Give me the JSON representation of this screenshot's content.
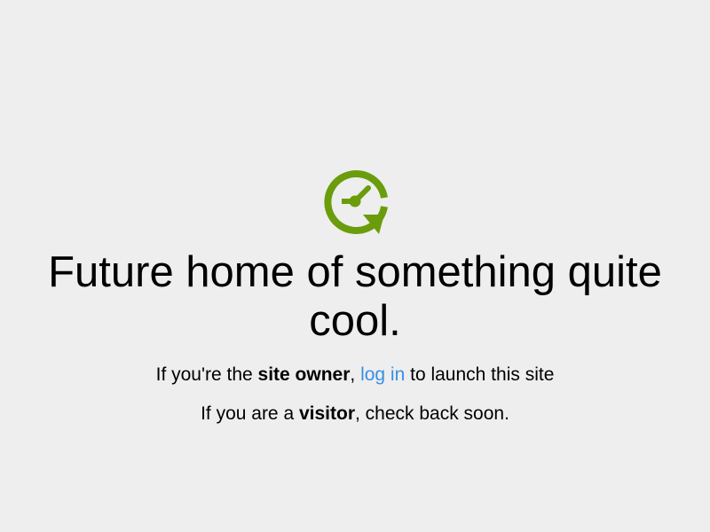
{
  "logo": {
    "icon": "clock-refresh-icon",
    "color": "#6a9c0c"
  },
  "heading": "Future home of something quite cool.",
  "owner_line": {
    "prefix": "If you're the ",
    "strong": "site owner",
    "comma": ", ",
    "link": "log in",
    "suffix": " to launch this site"
  },
  "visitor_line": {
    "prefix": "If you are a ",
    "strong": "visitor",
    "suffix": ", check back soon."
  }
}
